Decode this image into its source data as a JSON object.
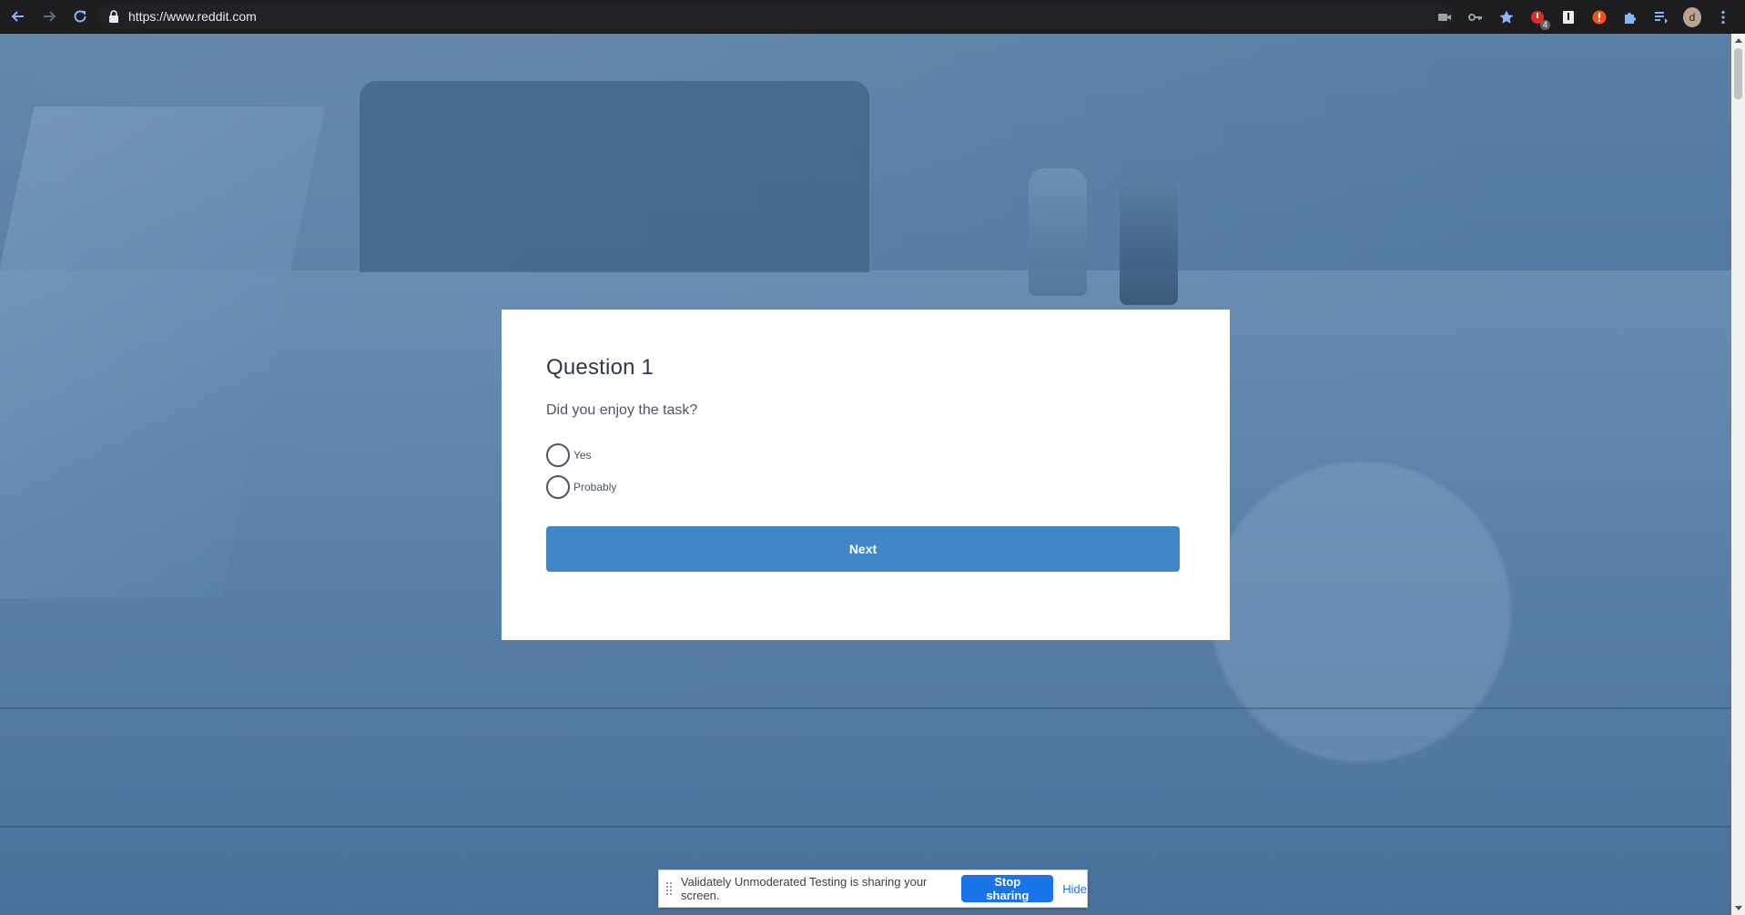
{
  "browser": {
    "url": "https://www.reddit.com",
    "profile_initial": "d",
    "extension_badge": "4",
    "icons": [
      "back-arrow-icon",
      "forward-arrow-icon",
      "reload-icon",
      "lock-icon",
      "camera-icon",
      "key-icon",
      "star-icon",
      "extension-icon",
      "puzzle-icon",
      "media-icon",
      "avatar",
      "more-icon"
    ]
  },
  "card": {
    "title": "Question 1",
    "question": "Did you enjoy the task?",
    "options": [
      "Yes",
      "Probably"
    ],
    "next_label": "Next"
  },
  "share_bar": {
    "message": "Validately Unmoderated Testing is sharing your screen.",
    "stop_label": "Stop sharing",
    "hide_label": "Hide"
  },
  "colors": {
    "accent": "#4187c7",
    "stop_button": "#1a73e8",
    "page_overlay": "#4f77a0"
  }
}
